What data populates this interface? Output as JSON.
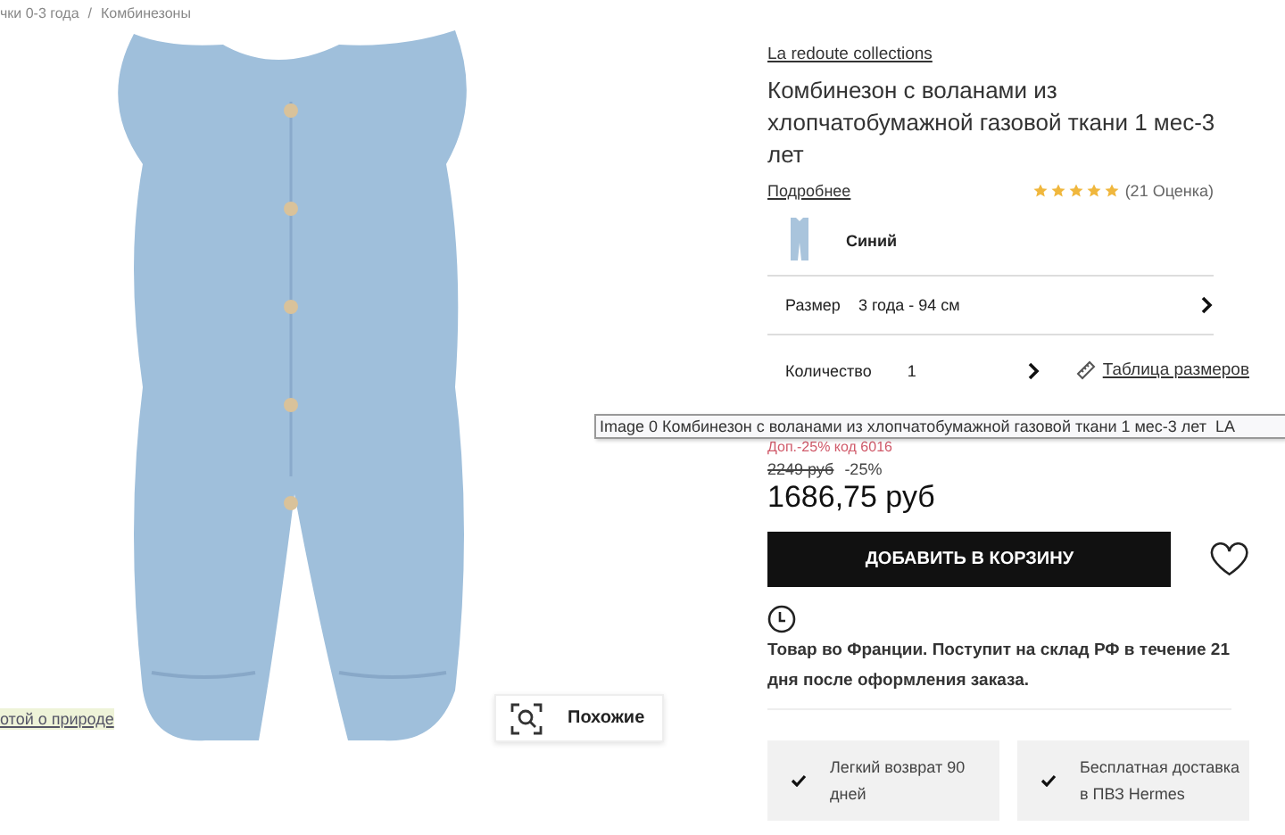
{
  "breadcrumb": {
    "items": [
      "чки 0-3 года",
      "Комбинезоны"
    ],
    "separator": "/"
  },
  "gallery": {
    "caption_link": "отой о природе",
    "similar_button": "Похожие"
  },
  "product": {
    "brand": "La redoute collections",
    "title": "Комбинезон с воланами из хлопчатобумажной газовой ткани 1 мес-3 лет",
    "details_link": "Подробнее",
    "rating": {
      "stars": 5,
      "count": "(21 Оценка)"
    },
    "color": {
      "name": "Синий"
    },
    "size": {
      "label": "Размер",
      "value": "3 года - 94 см"
    },
    "quantity": {
      "label": "Количество",
      "value": "1"
    },
    "size_chart_link": "Таблица размеров",
    "promo": "Доп.-25% код 6016",
    "old_price": "2249 руб",
    "discount": "-25%",
    "price": "1686,75 руб",
    "add_to_cart": "ДОБАВИТЬ В КОРЗИНУ",
    "favorite": false,
    "delivery_note": "Товар во Франции. Поступит на склад РФ в течение 21 дня после оформления заказа.",
    "benefits": [
      "Легкий возврат 90 дней",
      "Бесплатная доставка в ПВЗ Hermes"
    ]
  },
  "tooltip": "Image 0 Комбинезон с воланами из хлопчатобумажной газовой ткани 1 мес-3 лет  LA"
}
